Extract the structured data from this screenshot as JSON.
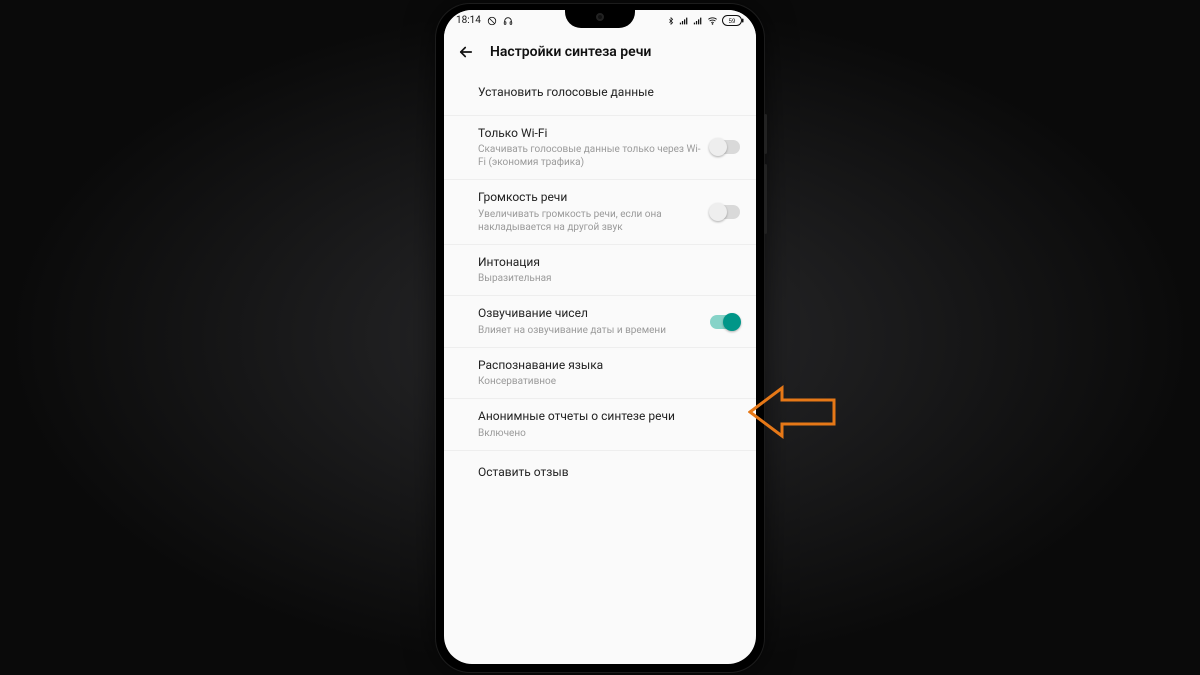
{
  "statusbar": {
    "time": "18:14",
    "battery": "59"
  },
  "appbar": {
    "title": "Настройки синтеза речи"
  },
  "rows": {
    "r0": {
      "title": "Установить голосовые данные"
    },
    "r1": {
      "title": "Только Wi-Fi",
      "sub": "Скачивать голосовые данные только через Wi-Fi (экономия трафика)"
    },
    "r2": {
      "title": "Громкость речи",
      "sub": "Увеличивать громкость речи, если она накладывается на другой звук"
    },
    "r3": {
      "title": "Интонация",
      "sub": "Выразительная"
    },
    "r4": {
      "title": "Озвучивание чисел",
      "sub": "Влияет на озвучивание даты и времени"
    },
    "r5": {
      "title": "Распознавание языка",
      "sub": "Консервативное"
    },
    "r6": {
      "title": "Анонимные отчеты о синтезе речи",
      "sub": "Включено"
    },
    "r7": {
      "title": "Оставить отзыв"
    }
  },
  "colors": {
    "arrow": "#e67817",
    "accent": "#009688"
  }
}
